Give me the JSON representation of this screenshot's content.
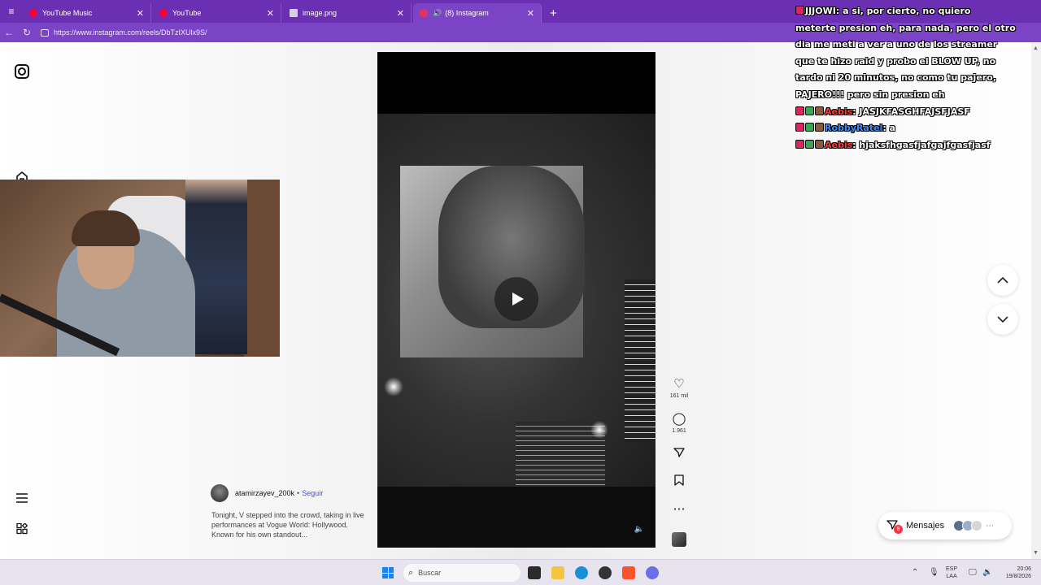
{
  "browser": {
    "tabs": [
      {
        "title": "YouTube Music",
        "favicon_color": "#ff0033",
        "active": false
      },
      {
        "title": "YouTube",
        "favicon_color": "#ff0033",
        "active": false
      },
      {
        "title": "image.png",
        "favicon_color": "#d8d0e6",
        "active": false
      },
      {
        "title": "(8) Instagram",
        "favicon_color": "#e1306c",
        "active": true,
        "audio": true
      }
    ],
    "url": "https://www.instagram.com/reels/DbTzIXUlx9S/"
  },
  "post": {
    "author": "atamirzayev_200k",
    "separator": "•",
    "follow_label": "Seguir",
    "caption": "Tonight, V stepped into the crowd, taking in live performances at Vogue World: Hollywood. Known for his own standout..."
  },
  "actions": {
    "likes": "161 mil",
    "comments": "1.961"
  },
  "messages": {
    "label": "Mensajes",
    "badge": "8"
  },
  "chat": {
    "messages": [
      {
        "user": "JJJOWI",
        "text": "a si, por cierto, no quiero meterte presion eh, para nada, pero el otro dia me meti a ver a uno de los streamer que te hizo raid y probo el BLOW UP, no tardo ni 20 minutos, no como tu pajero, PAJERO!!! pero sin presion eh"
      },
      {
        "user": "Aebis",
        "text": "JASJKFASGHFAJSFJASF"
      },
      {
        "user": "RobbyRatel",
        "text": "a"
      },
      {
        "user": "Aebis",
        "text": "hjaksfhgasfjafgajfgasfjasf"
      }
    ],
    "wrapped_first": [
      "a si, por cierto, no quiero",
      "meterte presion eh, para nada, pero el otro",
      "dia me meti a ver a uno de los streamer",
      "que te hizo raid y probo el BLOW UP, no",
      "tardo ni 20 minutos, no como tu pajero,",
      "PAJERO!!! pero sin presion eh"
    ],
    "colors": {
      "JJJOWI": "#ffffff",
      "Aebis": "#ff3b3b",
      "RobbyRatel": "#3d8bff"
    }
  },
  "taskbar": {
    "search_placeholder": "Buscar",
    "lang_top": "ESP",
    "lang_bottom": "LAA",
    "time": "20:06",
    "date": "19/8/2026"
  },
  "icons": {
    "instagram": "instagram-logo-icon",
    "home": "home-icon",
    "reels": "reels-icon",
    "menu": "menu-icon",
    "more": "more-apps-icon",
    "like": "heart-icon",
    "comment": "comment-icon",
    "share": "send-icon",
    "save": "bookmark-icon"
  }
}
